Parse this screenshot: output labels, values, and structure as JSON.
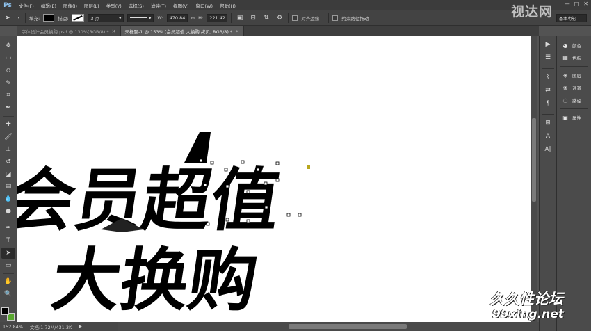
{
  "app": {
    "logo": "Ps"
  },
  "menu": [
    "文件(F)",
    "编辑(E)",
    "图像(I)",
    "图层(L)",
    "类型(Y)",
    "选择(S)",
    "滤镜(T)",
    "视图(V)",
    "窗口(W)",
    "帮助(H)"
  ],
  "window_controls": {
    "minimize": "—",
    "maximize": "□",
    "close": "✕"
  },
  "options": {
    "fill_label": "填充:",
    "stroke_label": "描边:",
    "stroke_width": "3 点",
    "w_label": "W:",
    "w_value": "470.84",
    "link_icon": "⊖",
    "h_label": "H:",
    "h_value": "221.42",
    "align_edges_label": "对齐边缘",
    "constrain_path_label": "约束路径拖动",
    "workspace": "基本功能"
  },
  "tabs": [
    {
      "label": "字体设计会员换购.psd @ 130%(RGB/8) *",
      "close": "×",
      "active": false
    },
    {
      "label": "未标题-1 @ 153% (会员超值 大换购 拷贝, RGB/8) *",
      "close": "×",
      "active": true
    }
  ],
  "tools": [
    {
      "name": "move-tool",
      "glyph": "✥"
    },
    {
      "name": "marquee-tool",
      "glyph": "⬚"
    },
    {
      "name": "lasso-tool",
      "glyph": "ଠ"
    },
    {
      "name": "quick-select-tool",
      "glyph": "✎"
    },
    {
      "name": "crop-tool",
      "glyph": "⌗"
    },
    {
      "name": "eyedropper-tool",
      "glyph": "✒"
    },
    {
      "name": "healing-tool",
      "glyph": "✚"
    },
    {
      "name": "brush-tool",
      "glyph": "🖌"
    },
    {
      "name": "stamp-tool",
      "glyph": "⊥"
    },
    {
      "name": "history-brush-tool",
      "glyph": "↺"
    },
    {
      "name": "eraser-tool",
      "glyph": "◪"
    },
    {
      "name": "gradient-tool",
      "glyph": "▤"
    },
    {
      "name": "blur-tool",
      "glyph": "💧"
    },
    {
      "name": "dodge-tool",
      "glyph": "●"
    },
    {
      "name": "pen-tool",
      "glyph": "✒"
    },
    {
      "name": "type-tool",
      "glyph": "T"
    },
    {
      "name": "path-select-tool",
      "glyph": "➤"
    },
    {
      "name": "shape-tool",
      "glyph": "▭"
    },
    {
      "name": "hand-tool",
      "glyph": "✋"
    },
    {
      "name": "zoom-tool",
      "glyph": "🔍"
    }
  ],
  "dock_icons": [
    {
      "name": "history-icon",
      "glyph": "▶"
    },
    {
      "name": "actions-icon",
      "glyph": "☰"
    },
    {
      "name": "brush-preset-icon",
      "glyph": "⌇"
    },
    {
      "name": "adjust-icon",
      "glyph": "⇄"
    },
    {
      "name": "paragraph-icon",
      "glyph": "¶"
    },
    {
      "name": "clone-source-icon",
      "glyph": "⊞"
    },
    {
      "name": "character-icon",
      "glyph": "A"
    },
    {
      "name": "char-style-icon",
      "glyph": "A|"
    }
  ],
  "panels": [
    {
      "name": "color",
      "icon": "◕",
      "label": "颜色"
    },
    {
      "name": "swatches",
      "icon": "▦",
      "label": "色板"
    },
    {
      "name": "layers",
      "icon": "◈",
      "label": "图层"
    },
    {
      "name": "channels",
      "icon": "❀",
      "label": "通道"
    },
    {
      "name": "paths",
      "icon": "◌",
      "label": "路径"
    },
    {
      "name": "properties",
      "icon": "▣",
      "label": "属性"
    }
  ],
  "status": {
    "zoom": "152.84%",
    "doc": "文档:1.72M/431.3K"
  },
  "canvas_text": {
    "line1": "会员超值",
    "line2": "大换购"
  },
  "watermarks": {
    "top": "视达网",
    "bottom_cn": "久久性论坛",
    "bottom_url": "99xing.net"
  },
  "colors": {
    "foreground": "#000000",
    "background": "#59a82f"
  }
}
